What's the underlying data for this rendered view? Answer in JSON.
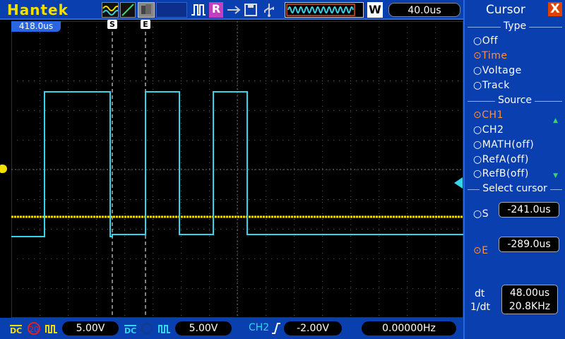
{
  "brand": "Hantek",
  "toolbar": {
    "rec_label": "R",
    "w_label": "W",
    "timebase": "40.0us"
  },
  "screen": {
    "trigger_pos_badge": "418.0us",
    "cursor_s_label": "S",
    "cursor_e_label": "E"
  },
  "bottom": {
    "ch1_coupling": "DC",
    "ch1_bw": "20",
    "ch1_volts": "5.00V",
    "ch2_coupling": "DC",
    "ch2_volts": "5.00V",
    "trigger_source": "CH2",
    "trigger_level": "-2.00V",
    "frequency": "0.00000Hz"
  },
  "panel": {
    "title": "Cursor",
    "close": "X",
    "type_title": "Type",
    "type_options": [
      "Off",
      "Time",
      "Voltage",
      "Track"
    ],
    "type_selected": 1,
    "source_title": "Source",
    "source_options": [
      "CH1",
      "CH2",
      "MATH(off)",
      "RefA(off)",
      "RefB(off)"
    ],
    "source_selected": 0,
    "select_title": "Select cursor",
    "s_label": "S",
    "s_value": "-241.0us",
    "e_label": "E",
    "e_value": "-289.0us",
    "dt_label": "dt",
    "dt_value": "48.00us",
    "inv_dt_label": "1/dt",
    "inv_dt_value": "20.8KHz"
  },
  "colors": {
    "ch1": "#f2e000",
    "ch2": "#35d4e8",
    "bar": "#0a3fb0",
    "selected_option": "#ff9040"
  }
}
